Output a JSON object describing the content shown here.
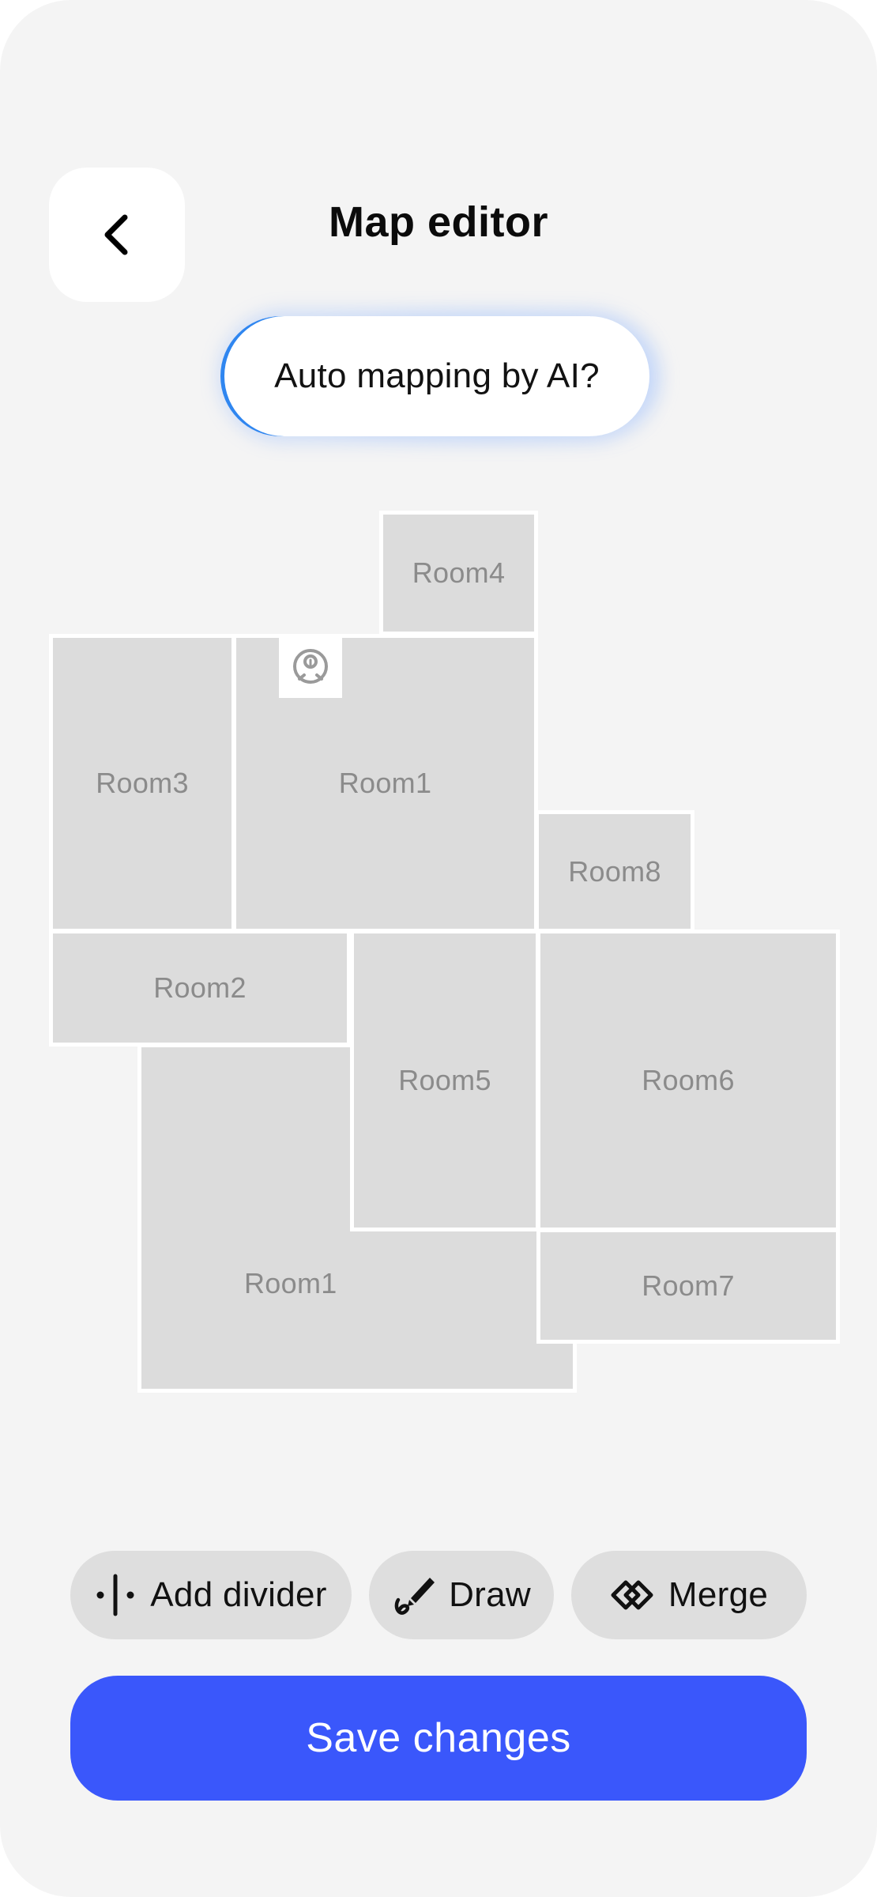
{
  "header": {
    "title": "Map editor",
    "back_icon": "chevron-left-icon"
  },
  "ai_prompt": {
    "label": "Auto mapping by AI?",
    "accent_color": "#2f86f0"
  },
  "map": {
    "rooms": [
      {
        "id": "room4",
        "label": "Room4"
      },
      {
        "id": "room3",
        "label": "Room3"
      },
      {
        "id": "room1-top",
        "label": "Room1"
      },
      {
        "id": "room8",
        "label": "Room8"
      },
      {
        "id": "room2",
        "label": "Room2"
      },
      {
        "id": "room5",
        "label": "Room5"
      },
      {
        "id": "room6",
        "label": "Room6"
      },
      {
        "id": "room1-bottom",
        "label": "Room1"
      },
      {
        "id": "room7",
        "label": "Room7"
      }
    ],
    "robot_icon": "robot-vacuum-icon",
    "room_color": "#dcdcdc"
  },
  "tools": [
    {
      "label": "Add divider",
      "icon": "divider-icon"
    },
    {
      "label": "Draw",
      "icon": "pen-icon"
    },
    {
      "label": "Merge",
      "icon": "merge-icon"
    }
  ],
  "save": {
    "label": "Save changes",
    "color": "#3a57fb"
  }
}
